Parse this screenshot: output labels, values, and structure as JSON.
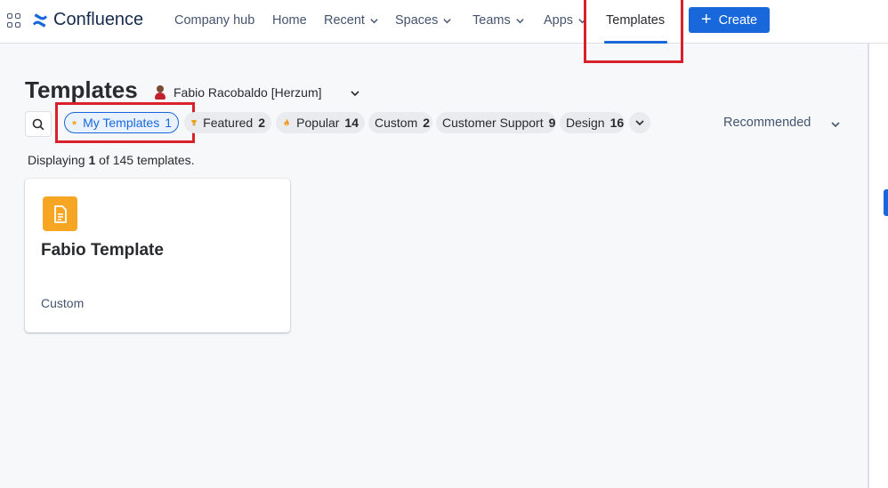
{
  "app": {
    "name": "Confluence",
    "brand_color": "#1868db"
  },
  "nav": {
    "items": [
      {
        "label": "Company hub",
        "dropdown": false
      },
      {
        "label": "Home",
        "dropdown": false
      },
      {
        "label": "Recent",
        "dropdown": true
      },
      {
        "label": "Spaces",
        "dropdown": true
      },
      {
        "label": "Teams",
        "dropdown": true
      },
      {
        "label": "Apps",
        "dropdown": true
      },
      {
        "label": "Templates",
        "dropdown": false,
        "active": true
      }
    ],
    "create_label": "Create"
  },
  "page": {
    "title": "Templates",
    "owner": "Fabio Racobaldo [Herzum]"
  },
  "filters": {
    "chips": [
      {
        "label": "My Templates",
        "count": "1",
        "icon": "star-icon",
        "selected": true
      },
      {
        "label": "Featured",
        "count": "2",
        "icon": "trophy-icon"
      },
      {
        "label": "Popular",
        "count": "14",
        "icon": "fire-icon"
      },
      {
        "label": "Custom",
        "count": "2"
      },
      {
        "label": "Customer Support",
        "count": "9"
      },
      {
        "label": "Design",
        "count": "16"
      }
    ],
    "sort_label": "Recommended"
  },
  "results": {
    "prefix": "Displaying ",
    "shown": "1",
    "suffix": " of 145 templates."
  },
  "cards": [
    {
      "title": "Fabio Template",
      "category": "Custom",
      "icon": "page-icon",
      "icon_color": "#f6a623"
    }
  ],
  "highlight_color": "#d9212c"
}
